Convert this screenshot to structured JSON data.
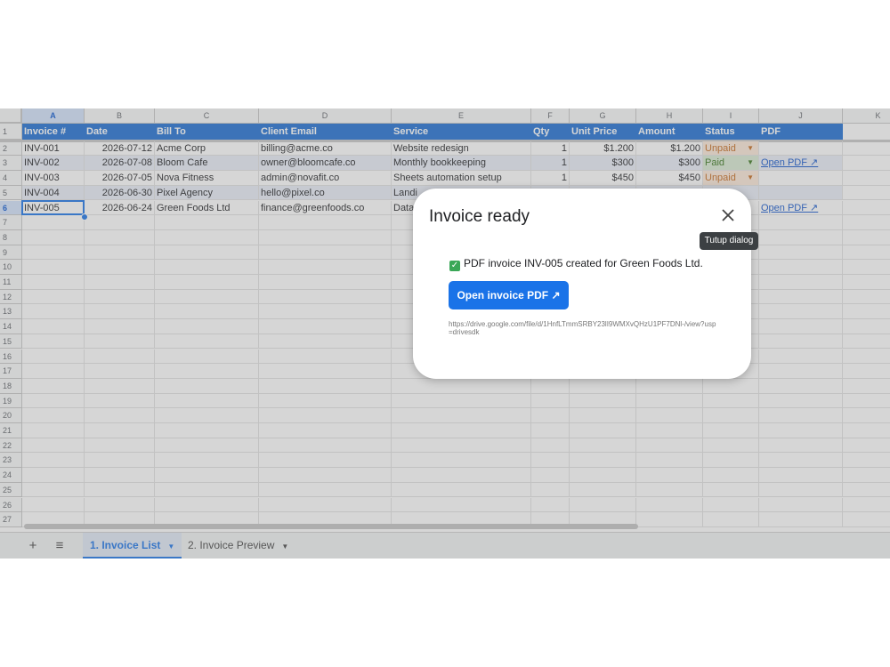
{
  "spreadsheet": {
    "columns": [
      "A",
      "B",
      "C",
      "D",
      "E",
      "F",
      "G",
      "H",
      "I",
      "J",
      "K"
    ],
    "selected_column": "A",
    "selected_row": "6",
    "row_numbers": [
      "1",
      "2",
      "3",
      "4",
      "5",
      "6",
      "7",
      "8",
      "9",
      "10",
      "11",
      "12",
      "13",
      "14",
      "15",
      "16",
      "17",
      "18",
      "19",
      "20",
      "21",
      "22",
      "23",
      "24",
      "25",
      "26",
      "27"
    ],
    "header_row": [
      "Invoice #",
      "Date",
      "Bill To",
      "Client Email",
      "Service",
      "Qty",
      "Unit Price",
      "Amount",
      "Status",
      "PDF"
    ],
    "rows": [
      {
        "invoice": "INV-001",
        "date": "2026-07-12",
        "bill_to": "Acme Corp",
        "email": "billing@acme.co",
        "service": "Website redesign",
        "qty": "1",
        "unit_price": "$1.200",
        "amount": "$1.200",
        "status": "Unpaid",
        "pdf": ""
      },
      {
        "invoice": "INV-002",
        "date": "2026-07-08",
        "bill_to": "Bloom Cafe",
        "email": "owner@bloomcafe.co",
        "service": "Monthly bookkeeping",
        "qty": "1",
        "unit_price": "$300",
        "amount": "$300",
        "status": "Paid",
        "pdf": "Open PDF ↗"
      },
      {
        "invoice": "INV-003",
        "date": "2026-07-05",
        "bill_to": "Nova Fitness",
        "email": "admin@novafit.co",
        "service": "Sheets automation setup",
        "qty": "1",
        "unit_price": "$450",
        "amount": "$450",
        "status": "Unpaid",
        "pdf": ""
      },
      {
        "invoice": "INV-004",
        "date": "2026-06-30",
        "bill_to": "Pixel Agency",
        "email": "hello@pixel.co",
        "service": "Landi",
        "qty": "",
        "unit_price": "",
        "amount": "",
        "status": "",
        "pdf": ""
      },
      {
        "invoice": "INV-005",
        "date": "2026-06-24",
        "bill_to": "Green Foods Ltd",
        "email": "finance@greenfoods.co",
        "service": "Data",
        "qty": "",
        "unit_price": "",
        "amount": "",
        "status": "",
        "pdf": "Open PDF ↗"
      }
    ],
    "colors": {
      "header": "#1c6ed3",
      "selection": "#1a73e8",
      "unpaid_bg": "#fde9d9",
      "paid_bg": "#d9ead3"
    }
  },
  "tabs": {
    "add_icon": "plus-icon",
    "list_icon": "menu-icon",
    "items": [
      {
        "label": "1. Invoice List",
        "active": true
      },
      {
        "label": "2. Invoice Preview",
        "active": false
      }
    ]
  },
  "dialog": {
    "title": "Invoice ready",
    "close_tooltip": "Tutup dialog",
    "message": "PDF invoice INV-005 created for Green Foods Ltd.",
    "check_icon": "check-icon",
    "button_label": "Open invoice PDF ↗",
    "url": "https://drive.google.com/file/d/1HnfLTmmSRBY23lI9WMXvQHzU1PF7DNl-/view?usp=drivesdk"
  }
}
